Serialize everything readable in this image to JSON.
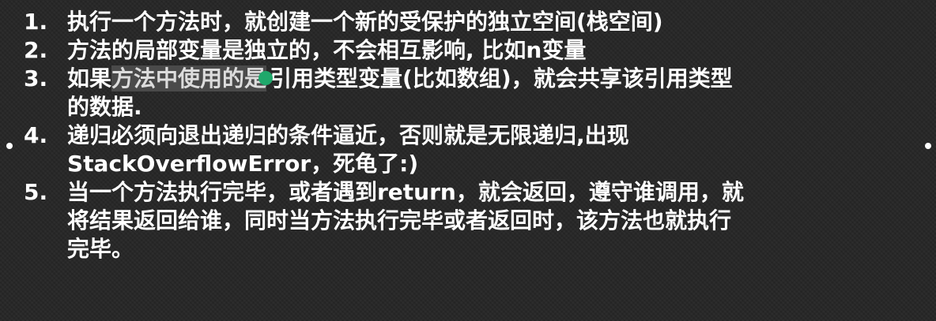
{
  "items": [
    {
      "number": "1.",
      "line1": "执行一个方法时，就创建一个新的受保护的独立空间(栈空间)"
    },
    {
      "number": "2.",
      "line1": "方法的局部变量是独立的，不会相互影响, 比如n变量"
    },
    {
      "number": "3.",
      "line1_pre": "如果",
      "line1_highlight": "方法中使用的是",
      "line1_post": "引用类型变量(比如数组)，就会共享该引用类型",
      "line2": "的数据."
    },
    {
      "number": "4.",
      "line1": "递归必须向退出递归的条件逼近，否则就是无限递归,出现",
      "line2": "StackOverflowError，死龟了:)"
    },
    {
      "number": "5.",
      "line1": "当一个方法执行完毕，或者遇到return，就会返回，遵守谁调用，就",
      "line2": "将结果返回给谁，同时当方法执行完毕或者返回时，该方法也就执行",
      "line3": "完毕。"
    }
  ],
  "colors": {
    "background": "#262626",
    "text": "#ffffff",
    "highlight": "#4a4a4a",
    "cursor": "#1fa86b"
  }
}
